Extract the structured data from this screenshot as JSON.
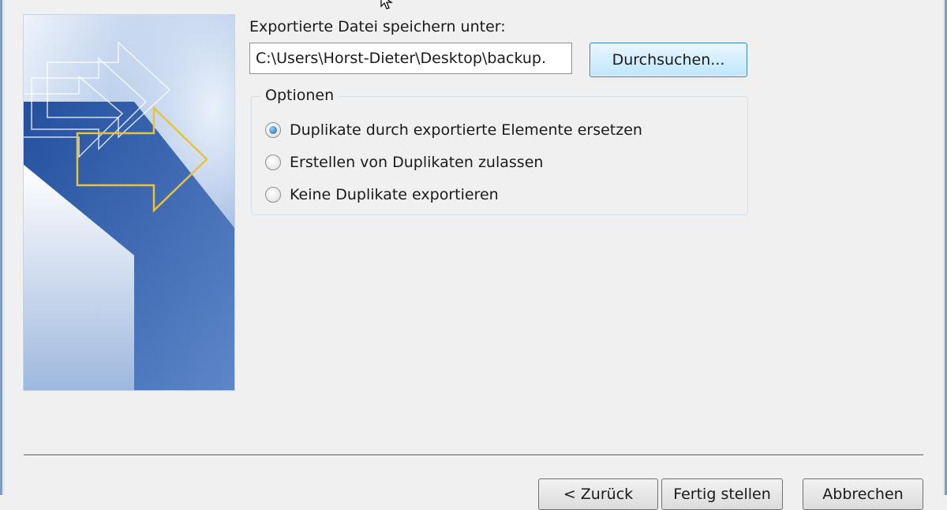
{
  "export_dialog": {
    "save_label": "Exportierte Datei speichern unter:",
    "file_path": "C:\\Users\\Horst-Dieter\\Desktop\\backup.",
    "browse_button": "Durchsuchen...",
    "options": {
      "title": "Optionen",
      "choices": [
        {
          "label": "Duplikate durch exportierte Elemente ersetzen",
          "selected": true
        },
        {
          "label": "Erstellen von Duplikaten zulassen",
          "selected": false
        },
        {
          "label": "Keine Duplikate exportieren",
          "selected": false
        }
      ]
    },
    "buttons": {
      "back": "< Zurück",
      "finish": "Fertig stellen",
      "cancel": "Abbrechen"
    }
  },
  "colors": {
    "accent_blue": "#2f5aa8",
    "arrow_gold": "#e8c33a",
    "dialog_background": "#f0f0f0"
  },
  "icons": [
    "mouse-cursor-icon",
    "export-arrow-graphic"
  ]
}
